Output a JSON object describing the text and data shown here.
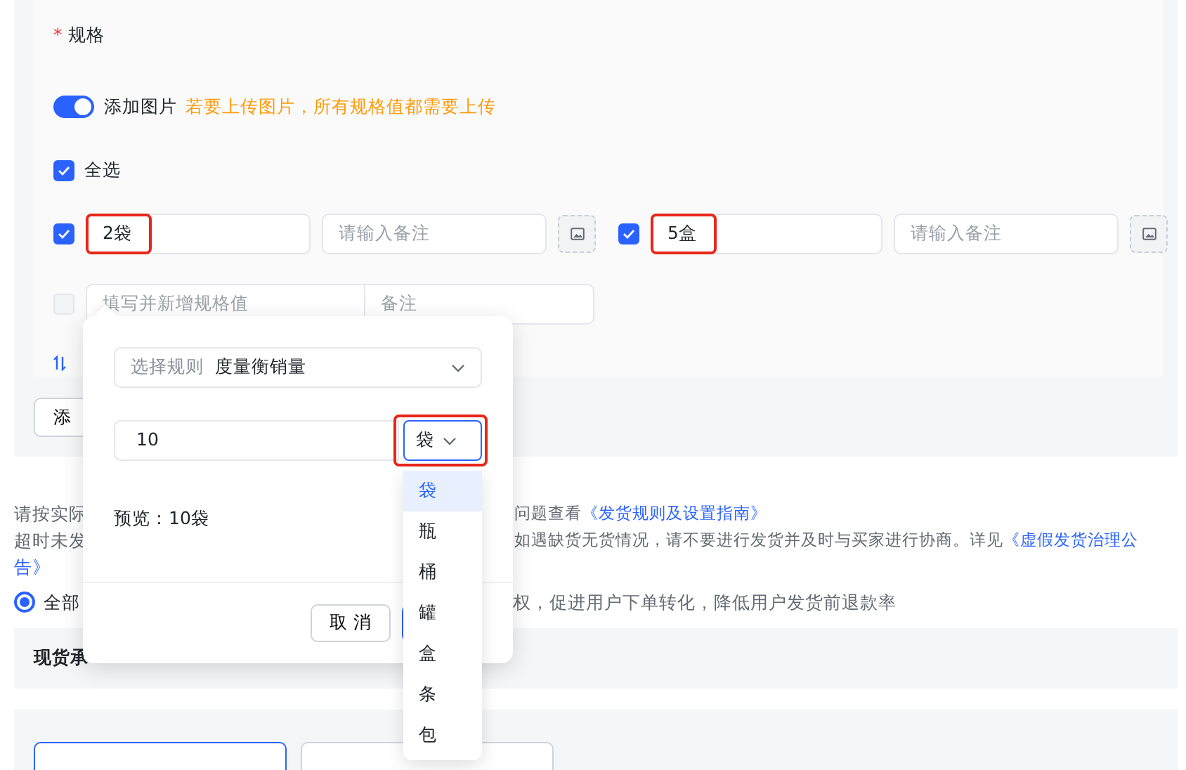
{
  "spec": {
    "required_mark": "*",
    "label": "规格",
    "image_toggle": {
      "label": "添加图片",
      "on": true,
      "hint": "若要上传图片，所有规格值都需要上传"
    },
    "select_all": {
      "label": "全选",
      "checked": true
    },
    "values": [
      {
        "value": "2袋",
        "checked": true,
        "annotated": true,
        "remark_placeholder": "请输入备注"
      },
      {
        "value": "5盒",
        "checked": true,
        "annotated": true,
        "remark_placeholder": "请输入备注"
      }
    ],
    "new_value": {
      "placeholder": "填写并新增规格值",
      "remark_placeholder": "备注",
      "disabled": true
    }
  },
  "add_button": {
    "label": "添"
  },
  "notice_lines": [
    {
      "left": "请按实际",
      "right": "问题查看",
      "link": "《发货规则及设置指南》"
    },
    {
      "left": "超时未发",
      "right": "如遇缺货无货情况，请不要进行发货并及时与买家进行协商。详见",
      "link": "《虚假发货治理公"
    }
  ],
  "notice_tail_link": "告》",
  "stock_option": {
    "label": "全部",
    "selected": true,
    "right": "权，促进用户下单转化，降低用户发货前退款率"
  },
  "stock_commit": {
    "label": "现货承"
  },
  "mode_cards": [
    {
      "selected": true
    },
    {
      "selected": false
    }
  ],
  "popover": {
    "rule_select": {
      "label": "选择规则",
      "value": "度量衡销量"
    },
    "amount": "10",
    "unit": {
      "value": "袋",
      "annotated": true
    },
    "preview": "预览：10袋",
    "cancel": "取 消"
  },
  "unit_options": [
    {
      "label": "袋",
      "selected": true
    },
    {
      "label": "瓶",
      "selected": false
    },
    {
      "label": "桶",
      "selected": false
    },
    {
      "label": "罐",
      "selected": false
    },
    {
      "label": "盒",
      "selected": false
    },
    {
      "label": "条",
      "selected": false
    },
    {
      "label": "包",
      "selected": false
    }
  ]
}
